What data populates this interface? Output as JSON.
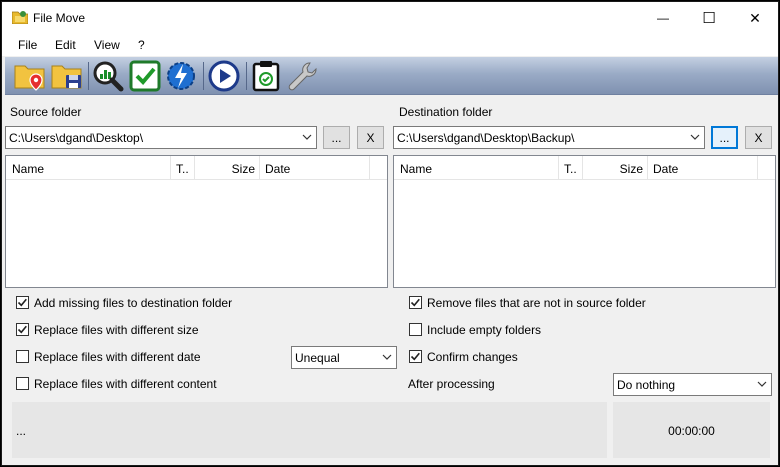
{
  "window": {
    "title": "File Move",
    "icon": "folder-app-icon"
  },
  "title_controls": {
    "minimize": "—",
    "maximize": "☐",
    "close": "✕"
  },
  "menu": [
    "File",
    "Edit",
    "View",
    "?"
  ],
  "toolbar": {
    "buttons": [
      "source-folder-icon",
      "destination-folder-icon",
      "compare-magnifier-icon",
      "check-icon",
      "lightning-gear-icon",
      "play-icon",
      "clipboard-check-icon",
      "wrench-icon"
    ]
  },
  "source": {
    "label": "Source folder",
    "path": "C:\\Users\\dgand\\Desktop\\",
    "browse_label": "...",
    "clear_label": "X",
    "columns": [
      "Name",
      "T..",
      "Size",
      "Date"
    ]
  },
  "destination": {
    "label": "Destination folder",
    "path": "C:\\Users\\dgand\\Desktop\\Backup\\",
    "browse_label": "...",
    "clear_label": "X",
    "columns": [
      "Name",
      "T..",
      "Size",
      "Date"
    ]
  },
  "options": {
    "add_missing": {
      "label": "Add missing files to destination folder",
      "checked": true
    },
    "replace_size": {
      "label": "Replace files with different size",
      "checked": true
    },
    "replace_date": {
      "label": "Replace files with different date",
      "checked": false
    },
    "replace_content": {
      "label": "Replace files with different content",
      "checked": false
    },
    "remove_not_in_source": {
      "label": "Remove files that are not in source folder",
      "checked": true
    },
    "include_empty": {
      "label": "Include empty folders",
      "checked": false
    },
    "confirm_changes": {
      "label": "Confirm changes",
      "checked": true
    },
    "date_mode": "Unequal",
    "after_processing_label": "After processing",
    "after_processing_value": "Do nothing"
  },
  "status": {
    "message": "...",
    "timer": "00:00:00"
  },
  "colors": {
    "accent": "#0078d7",
    "toolbar_top": "#c4d0e2",
    "toolbar_bottom": "#7f91b0"
  }
}
